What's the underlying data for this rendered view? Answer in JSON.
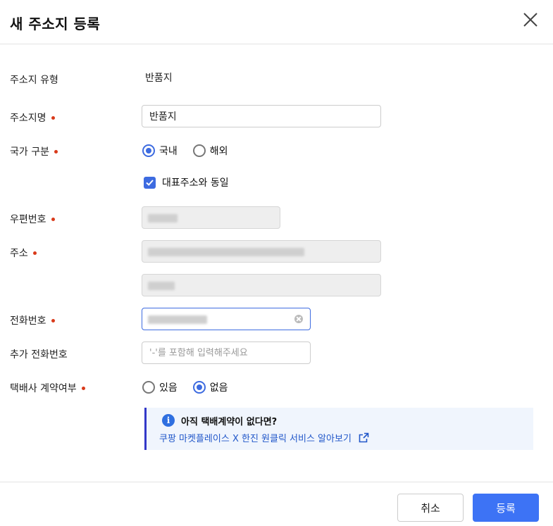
{
  "dialog": {
    "title": "새 주소지 등록"
  },
  "fields": {
    "type": {
      "label": "주소지 유형",
      "value": "반품지"
    },
    "name": {
      "label": "주소지명",
      "value": "반품지"
    },
    "country": {
      "label": "국가 구분",
      "options": [
        "국내",
        "해외"
      ],
      "selected": "국내"
    },
    "same_as_main": {
      "label": "대표주소와 동일",
      "checked": true
    },
    "zipcode": {
      "label": "우편번호"
    },
    "address": {
      "label": "주소"
    },
    "phone": {
      "label": "전화번호"
    },
    "extra_phone": {
      "label": "추가 전화번호",
      "placeholder": "'-'를 포함해 입력해주세요"
    },
    "courier_contract": {
      "label": "택배사 계약여부",
      "options": [
        "있음",
        "없음"
      ],
      "selected": "없음"
    }
  },
  "info": {
    "title": "아직 택배계약이 없다면?",
    "link": "쿠팡 마켓플레이스 X 한진 원클릭 서비스 알아보기"
  },
  "footer": {
    "cancel": "취소",
    "submit": "등록"
  },
  "colors": {
    "accent": "#3d73f5",
    "required": "#d93a1a",
    "link": "#2157c9"
  },
  "icons": {
    "close": "close-icon",
    "info": "info-icon",
    "external": "external-link-icon",
    "check": "check-icon",
    "clear": "clear-icon"
  }
}
